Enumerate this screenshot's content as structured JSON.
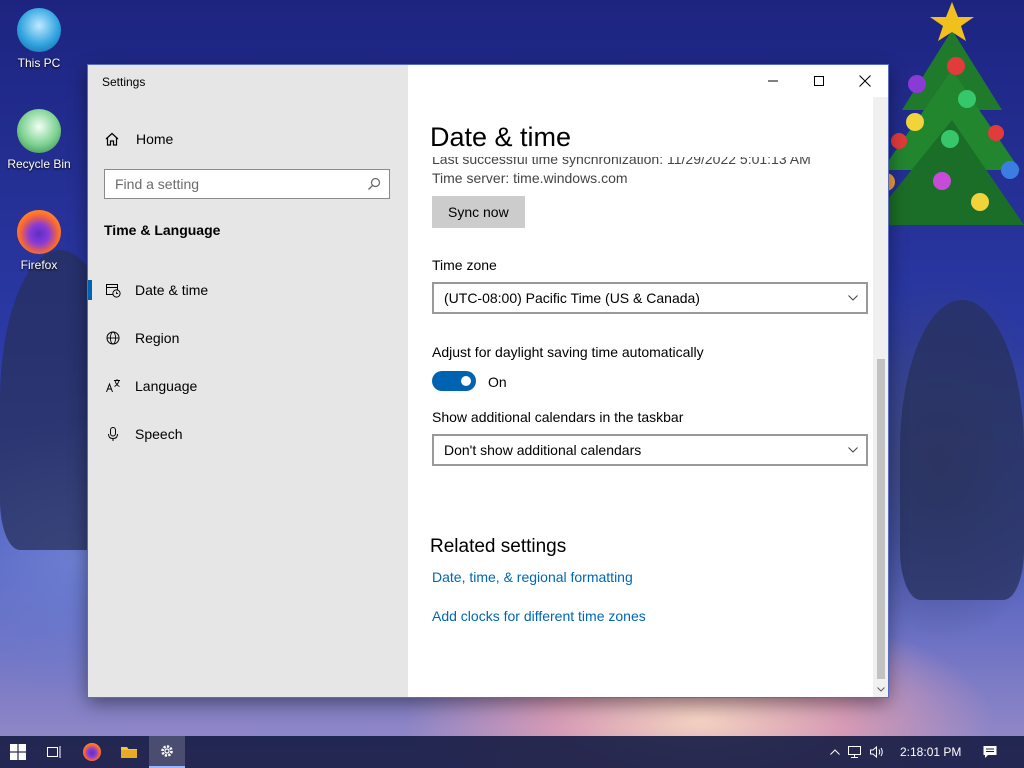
{
  "desktop": {
    "icons": [
      {
        "label": "This PC",
        "icon": "this-pc-icon"
      },
      {
        "label": "Recycle Bin",
        "icon": "recycle-bin-icon"
      },
      {
        "label": "Firefox",
        "icon": "firefox-icon"
      }
    ]
  },
  "window": {
    "title": "Settings",
    "controls": {
      "minimize": "minimize-icon",
      "maximize": "maximize-icon",
      "close": "close-icon"
    }
  },
  "sidebar": {
    "home_label": "Home",
    "search_placeholder": "Find a setting",
    "section_title": "Time & Language",
    "items": [
      {
        "label": "Date & time",
        "icon": "calendar-clock-icon",
        "active": true
      },
      {
        "label": "Region",
        "icon": "globe-icon",
        "active": false
      },
      {
        "label": "Language",
        "icon": "language-icon",
        "active": false
      },
      {
        "label": "Speech",
        "icon": "microphone-icon",
        "active": false
      }
    ]
  },
  "content": {
    "title": "Date & time",
    "last_sync": "Last successful time synchronization: 11/29/2022 5:01:13 AM",
    "time_server": "Time server: time.windows.com",
    "sync_button": "Sync now",
    "time_zone_label": "Time zone",
    "time_zone_value": "(UTC-08:00) Pacific Time (US & Canada)",
    "dst_label": "Adjust for daylight saving time automatically",
    "dst_state": "On",
    "calendars_label": "Show additional calendars in the taskbar",
    "calendars_value": "Don't show additional calendars",
    "related_title": "Related settings",
    "related_links": [
      "Date, time, & regional formatting",
      "Add clocks for different time zones"
    ]
  },
  "taskbar": {
    "items": [
      "start-icon",
      "task-view-icon",
      "firefox-icon",
      "file-explorer-icon",
      "settings-icon"
    ],
    "active_item": "settings-icon",
    "tray_icons": [
      "chevron-up-icon",
      "network-icon",
      "volume-icon"
    ],
    "clock": "2:18:01 PM",
    "notification_icon": "notification-icon"
  },
  "colors": {
    "accent": "#0063b1",
    "link": "#0066b4",
    "sidebar_bg": "#e6e6e6",
    "taskbar_bg": "#191e46"
  }
}
